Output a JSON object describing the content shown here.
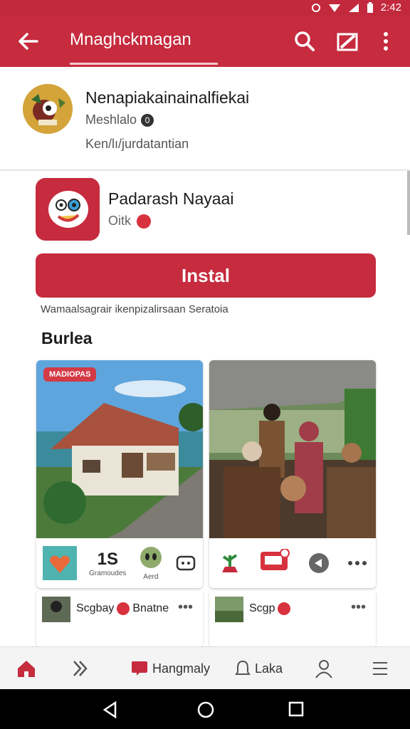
{
  "status": {
    "time": "2:42"
  },
  "appbar": {
    "title": "Mnaghckmagan",
    "back_icon": "arrow-left-icon",
    "search_icon": "search-icon",
    "edit_icon": "edit-icon",
    "more_icon": "more-vert-icon"
  },
  "developer": {
    "name": "Nenapiakainainalfiekai",
    "sub": "Meshlalo",
    "sub_badge": "0",
    "link": "Ken/lı/jurdatantian"
  },
  "app": {
    "name": "Padarash Nayaai",
    "meta": "Oitk"
  },
  "install": {
    "label": "Instal"
  },
  "note": "Wamaalsagrair ikenpizalirsaan Seratoia",
  "section": {
    "title": "Burlea"
  },
  "tiles": [
    {
      "badge": "MADIOPAS",
      "count": "1S",
      "count_caption": "Gramoudes",
      "alien_caption": "Aerd"
    },
    {
      "badge": ""
    }
  ],
  "subcards": [
    {
      "label": "Scgbay",
      "label2": "Bnatne"
    },
    {
      "label": "Scgp"
    }
  ],
  "bottomnav": {
    "item4_label": "Hangmaly",
    "item5_label": "Laka"
  },
  "colors": {
    "brand": "#c62b3e",
    "accent_dot": "#d8323f"
  }
}
